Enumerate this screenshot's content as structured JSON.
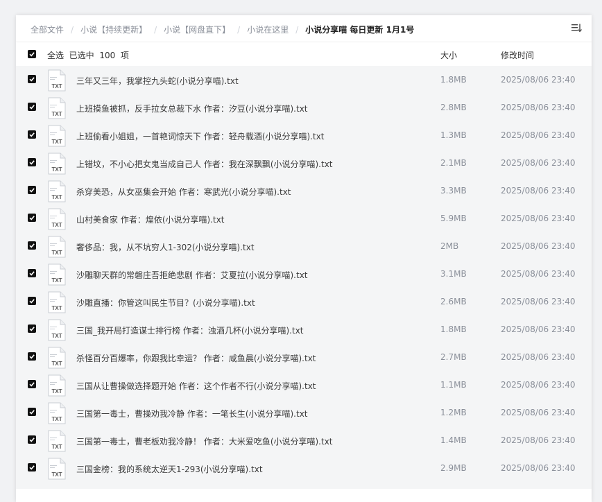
{
  "breadcrumb": {
    "items": [
      "全部文件",
      "小说【持续更新】",
      "小说【网盘直下】",
      "小说在这里"
    ],
    "current": "小说分享喵 每日更新 1月1号",
    "separator": "/"
  },
  "header": {
    "select_all": "全选",
    "selected_text": "已选中",
    "selected_count": "100",
    "selected_unit": "项",
    "size_label": "大小",
    "time_label": "修改时间"
  },
  "icons": {
    "file_icon_label": "TXT",
    "list_view": "list-view-icon",
    "checkbox": "checkbox-checked-icon"
  },
  "colors": {
    "row_bg": "#f4f5f6",
    "checkbox": "#111111",
    "muted_text": "#8a8f99"
  },
  "files": [
    {
      "name": "三年又三年，我掌控九头蛇(小说分享喵).txt",
      "size": "1.8MB",
      "time": "2025/08/06 23:40"
    },
    {
      "name": "上班摸鱼被抓，反手拉女总裁下水 作者：汐豆(小说分享喵).txt",
      "size": "2.8MB",
      "time": "2025/08/06 23:40"
    },
    {
      "name": "上班偷看小姐姐，一首艳词惊天下 作者：轻舟载酒(小说分享喵).txt",
      "size": "1.3MB",
      "time": "2025/08/06 23:40"
    },
    {
      "name": "上错坟，不小心把女鬼当成自己人 作者：我在深飘飘(小说分享喵).txt",
      "size": "2.1MB",
      "time": "2025/08/06 23:40"
    },
    {
      "name": "杀穿美恐，从女巫集会开始 作者：寒武光(小说分享喵).txt",
      "size": "3.3MB",
      "time": "2025/08/06 23:40"
    },
    {
      "name": "山村美食家 作者：煌依(小说分享喵).txt",
      "size": "5.9MB",
      "time": "2025/08/06 23:40"
    },
    {
      "name": "奢侈品：我，从不坑穷人1-302(小说分享喵).txt",
      "size": "2MB",
      "time": "2025/08/06 23:40"
    },
    {
      "name": "沙雕聊天群的常磐庄吾拒绝悲剧 作者：艾夏拉(小说分享喵).txt",
      "size": "3.1MB",
      "time": "2025/08/06 23:40"
    },
    {
      "name": "沙雕直播：你管这叫民生节目？(小说分享喵).txt",
      "size": "2.6MB",
      "time": "2025/08/06 23:40"
    },
    {
      "name": "三国_我开局打造谋士排行榜 作者：浊酒几杯(小说分享喵).txt",
      "size": "1.8MB",
      "time": "2025/08/06 23:40"
    },
    {
      "name": "杀怪百分百爆率，你跟我比幸运？ 作者：咸鱼晨(小说分享喵).txt",
      "size": "2.7MB",
      "time": "2025/08/06 23:40"
    },
    {
      "name": "三国从让曹操做选择题开始 作者：这个作者不行(小说分享喵).txt",
      "size": "1.1MB",
      "time": "2025/08/06 23:40"
    },
    {
      "name": "三国第一毒士，曹操劝我冷静 作者：一笔长生(小说分享喵).txt",
      "size": "1.2MB",
      "time": "2025/08/06 23:40"
    },
    {
      "name": "三国第一毒士，曹老板劝我冷静！ 作者：大米爱吃鱼(小说分享喵).txt",
      "size": "1.4MB",
      "time": "2025/08/06 23:40"
    },
    {
      "name": "三国金榜：我的系统太逆天1-293(小说分享喵).txt",
      "size": "2.9MB",
      "time": "2025/08/06 23:40"
    }
  ]
}
